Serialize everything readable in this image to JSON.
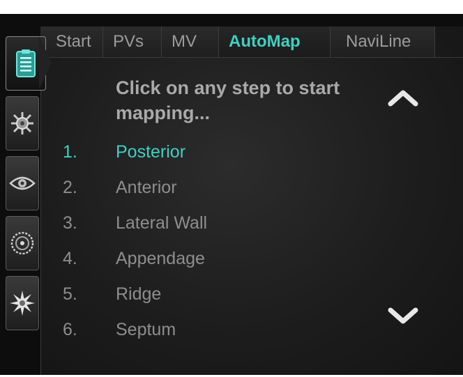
{
  "tabs": [
    {
      "label": "Start",
      "active": false
    },
    {
      "label": "PVs",
      "active": false
    },
    {
      "label": "MV",
      "active": false
    },
    {
      "label": "AutoMap",
      "active": true
    },
    {
      "label": "NaviLine",
      "active": false
    }
  ],
  "sidebar": {
    "items": [
      {
        "icon": "clipboard-icon",
        "active": true
      },
      {
        "icon": "gear-wheel-icon",
        "active": false
      },
      {
        "icon": "eye-icon",
        "active": false
      },
      {
        "icon": "dial-icon",
        "active": false
      },
      {
        "icon": "starburst-icon",
        "active": false
      }
    ]
  },
  "main": {
    "instruction": "Click on any step to start mapping...",
    "steps": [
      {
        "number": "1.",
        "label": "Posterior",
        "selected": true
      },
      {
        "number": "2.",
        "label": "Anterior",
        "selected": false
      },
      {
        "number": "3.",
        "label": "Lateral Wall",
        "selected": false
      },
      {
        "number": "4.",
        "label": "Appendage",
        "selected": false
      },
      {
        "number": "5.",
        "label": "Ridge",
        "selected": false
      },
      {
        "number": "6.",
        "label": "Septum",
        "selected": false
      }
    ],
    "scroll_up_icon": "chevron-up-icon",
    "scroll_down_icon": "chevron-down-icon"
  },
  "colors": {
    "accent": "#3fd0c2",
    "text_muted": "#8e8e8e",
    "background": "#1d1d1d"
  }
}
